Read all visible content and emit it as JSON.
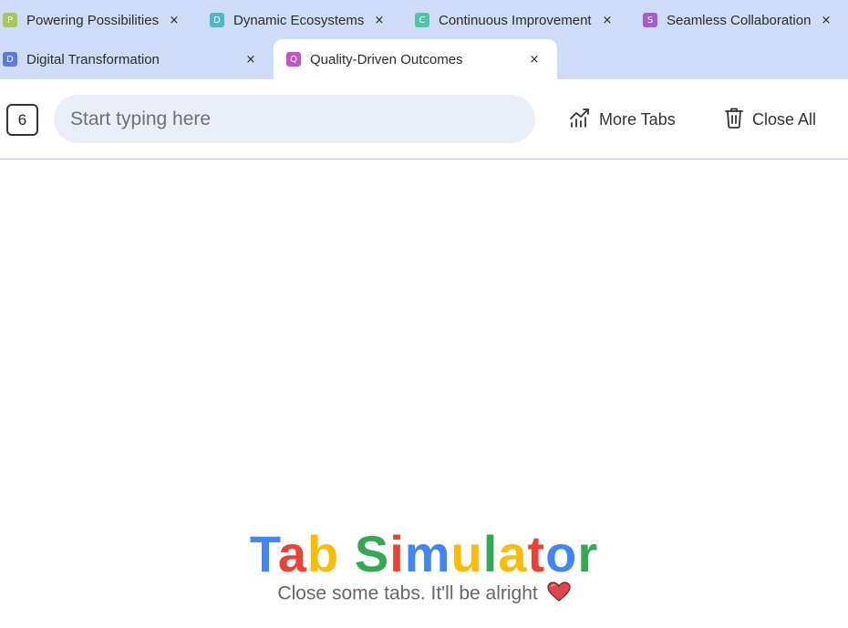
{
  "tabs_row1": [
    {
      "favicon": "P",
      "color": "#a6c85a",
      "title": "Powering Possibilities",
      "close": "×"
    },
    {
      "favicon": "D",
      "color": "#4fb7c9",
      "title": "Dynamic Ecosystems",
      "close": "×"
    },
    {
      "favicon": "C",
      "color": "#4cc9a0",
      "title": "Continuous Improvement",
      "close": "×"
    },
    {
      "favicon": "S",
      "color": "#a85bd0",
      "title": "Seamless Collaboration",
      "close": "×"
    }
  ],
  "tabs_row2": [
    {
      "favicon": "D",
      "color": "#5b7bd6",
      "title": "Digital Transformation",
      "close": "×"
    },
    {
      "favicon": "Q",
      "color": "#c155c2",
      "title": "Quality-Driven Outcomes",
      "close": "×",
      "active": true
    }
  ],
  "toolbar": {
    "tab_count": "6",
    "search_placeholder": "Start typing here",
    "more_tabs_label": "More Tabs",
    "close_all_label": "Close All"
  },
  "branding": {
    "title_letters": [
      {
        "ch": "T",
        "color": "#4285f4"
      },
      {
        "ch": "a",
        "color": "#ea4335"
      },
      {
        "ch": "b",
        "color": "#fbbc05"
      },
      {
        "ch": " ",
        "color": "#000000"
      },
      {
        "ch": "S",
        "color": "#34a853"
      },
      {
        "ch": "i",
        "color": "#ea4335"
      },
      {
        "ch": "m",
        "color": "#4285f4"
      },
      {
        "ch": "u",
        "color": "#fbbc05"
      },
      {
        "ch": "l",
        "color": "#34a853"
      },
      {
        "ch": "a",
        "color": "#fbbc05"
      },
      {
        "ch": "t",
        "color": "#ea4335"
      },
      {
        "ch": "o",
        "color": "#4285f4"
      },
      {
        "ch": "r",
        "color": "#34a853"
      }
    ],
    "tagline": "Close some tabs. It'll be alright"
  },
  "colors": {
    "tabstrip_bg": "#cfdcf7",
    "search_bg": "#e9eef8",
    "heart": "#e0454f"
  },
  "icons": [
    "chart-line-icon",
    "trash-icon",
    "heart-icon",
    "close-icon"
  ]
}
